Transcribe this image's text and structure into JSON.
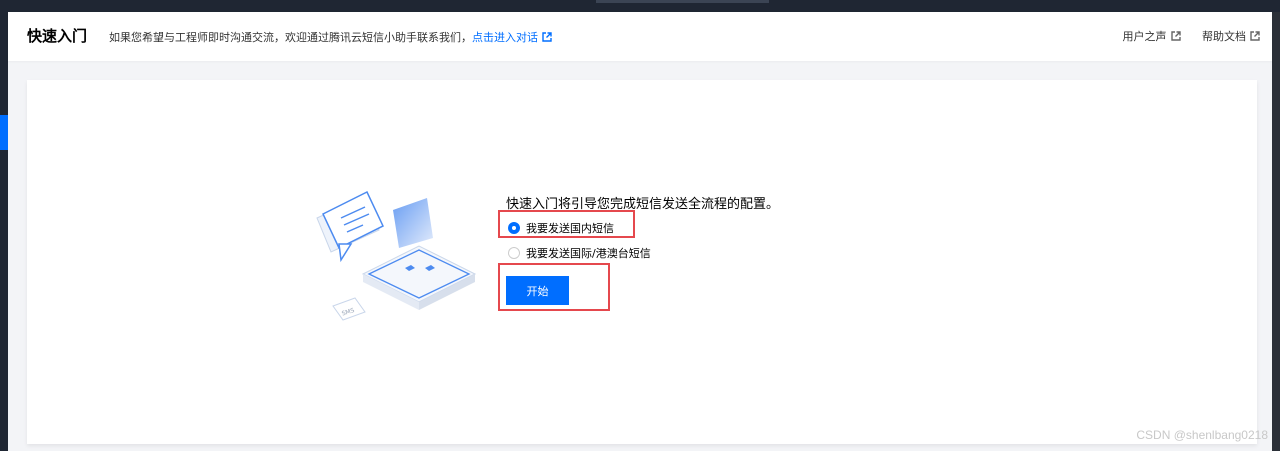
{
  "header": {
    "title": "快速入门",
    "description": "如果您希望与工程师即时沟通交流，欢迎通过腾讯云短信小助手联系我们，",
    "chat_link": "点击进入对话",
    "links": [
      "用户之声",
      "帮助文档"
    ]
  },
  "guide": {
    "intro": "快速入门将引导您完成短信发送全流程的配置。",
    "options": [
      {
        "label": "我要发送国内短信",
        "checked": true
      },
      {
        "label": "我要发送国际/港澳台短信",
        "checked": false
      }
    ],
    "start_label": "开始",
    "illustration_badge": "SMS"
  },
  "colors": {
    "accent": "#006eff",
    "highlight": "#e5484d"
  },
  "watermark": "CSDN @shenlbang0218"
}
